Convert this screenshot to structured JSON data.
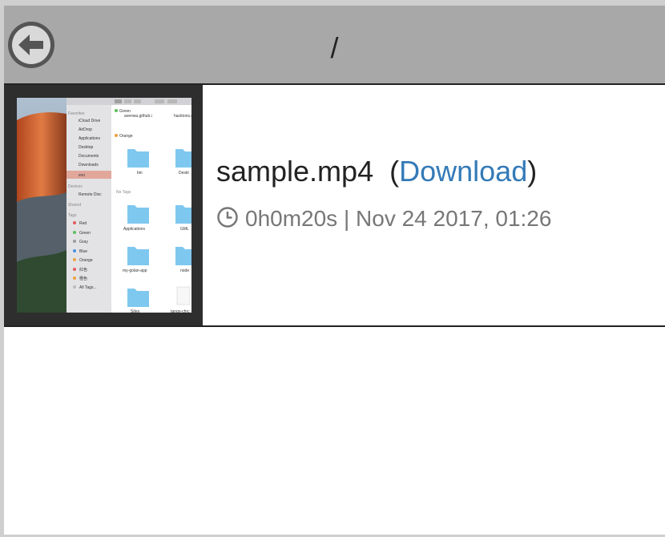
{
  "header": {
    "path": "/",
    "back_icon": "arrow-left-circle-icon"
  },
  "file": {
    "name": "sample.mp4",
    "open_paren": "(",
    "download_label": "Download",
    "close_paren": ")",
    "duration": "0h0m20s",
    "separator": "|",
    "date": "Nov 24 2017, 01:26",
    "clock_icon": "clock-icon"
  },
  "thumbnail": {
    "sidebar_sections": [
      "Favorites",
      "Devices",
      "Shared",
      "Tags"
    ],
    "sidebar_items": [
      "iCloud Drive",
      "AirDrop",
      "Applications",
      "Desktop",
      "Documents",
      "Downloads",
      "evo",
      "Remote Disc",
      "Red",
      "Green",
      "Gray",
      "Blue",
      "Orange",
      "红色",
      "橙色",
      "All Tags..."
    ],
    "groups": [
      "Green",
      "Orange",
      "No Tags"
    ],
    "files": [
      "avenwu.github.i",
      "hacktons.g",
      "bin",
      "Deskt",
      "Applications",
      "GML",
      "my-golan-app",
      "node",
      "Sites",
      "tango-chrc"
    ]
  },
  "colors": {
    "header_bg": "#a8a8a8",
    "link": "#337ab7",
    "meta": "#777777",
    "folder": "#7ec8f0"
  }
}
